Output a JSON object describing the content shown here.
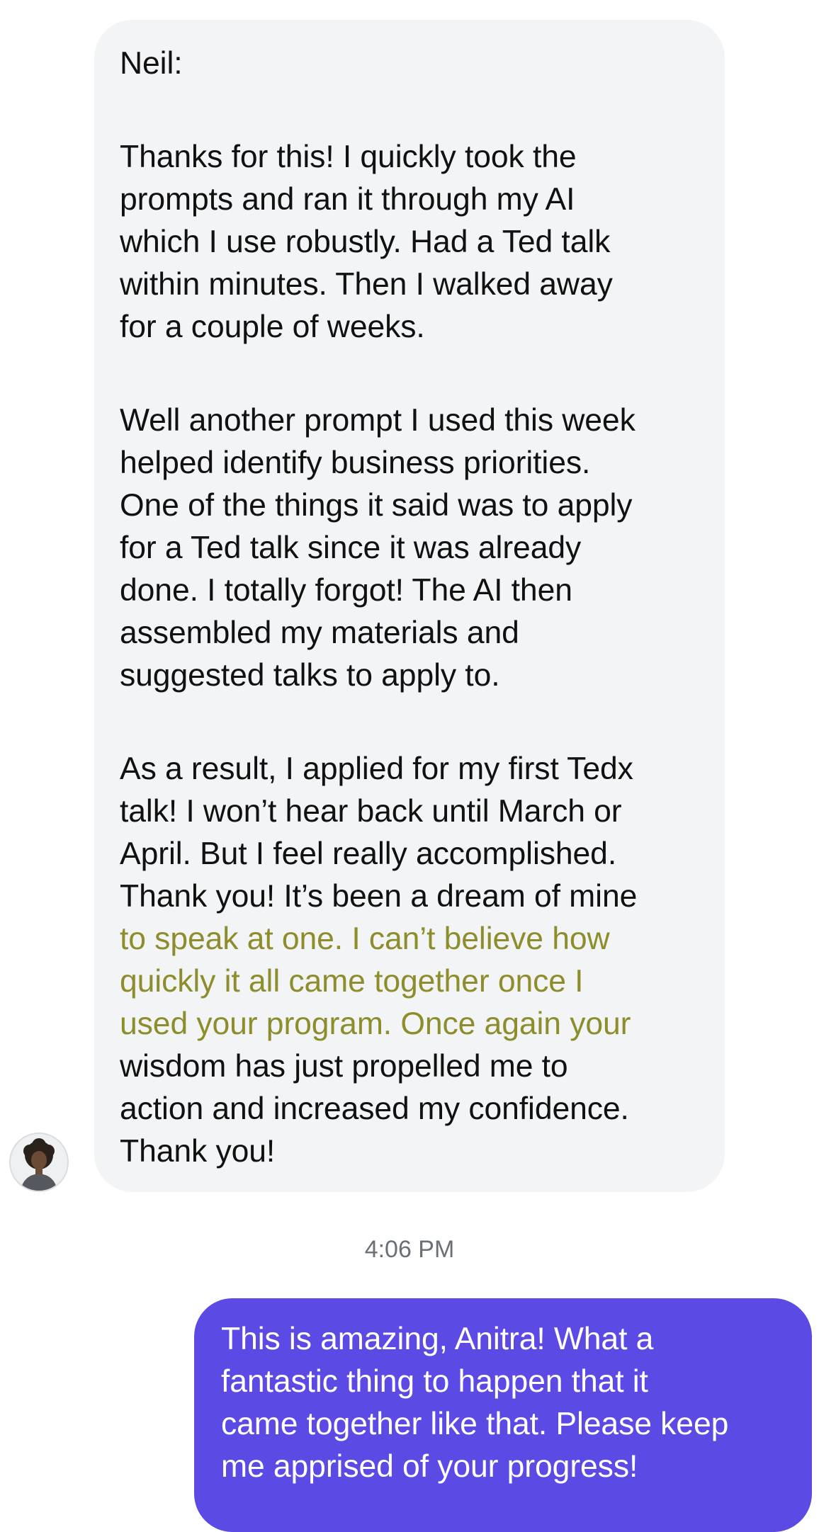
{
  "incoming_message": {
    "sender_label": "Neil:",
    "paragraph_1": [
      "Thanks for this! I quickly took the",
      "prompts and ran it through my AI",
      "which I use robustly. Had a Ted talk",
      "within minutes. Then I walked away",
      "for a couple of weeks."
    ],
    "paragraph_2": [
      "Well another prompt I used this week",
      "helped identify business priorities.",
      "One of the things it said was to apply",
      "for a Ted talk since it was already",
      "done. I totally forgot! The AI then",
      "assembled my materials and",
      "suggested talks to apply to."
    ],
    "paragraph_3_before": [
      "As a result, I applied for my first Tedx",
      "talk! I won’t hear back until March or",
      "April. But I feel really accomplished.",
      "Thank you! It’s been a dream of mine"
    ],
    "paragraph_3_highlighted": [
      "to speak at one. I can’t believe how",
      "quickly it all came together once I",
      "used your program. Once again your"
    ],
    "paragraph_3_after": [
      "wisdom has just propelled me to",
      "action and increased my confidence.",
      "Thank you!"
    ]
  },
  "timestamp": "4:06 PM",
  "outgoing_message": {
    "lines": [
      "This is amazing, Anitra! What a",
      "fantastic thing to happen that it",
      "came together like that. Please keep",
      "me apprised of your progress!"
    ]
  },
  "colors": {
    "incoming_bubble": "#f2f4f6",
    "outgoing_bubble": "#5b4ae4",
    "highlight": "#f3f386",
    "highlight_text": "#8d8d2c",
    "timestamp_text": "#6b6f76"
  },
  "icons": {
    "avatar": "contact-avatar-photo"
  }
}
